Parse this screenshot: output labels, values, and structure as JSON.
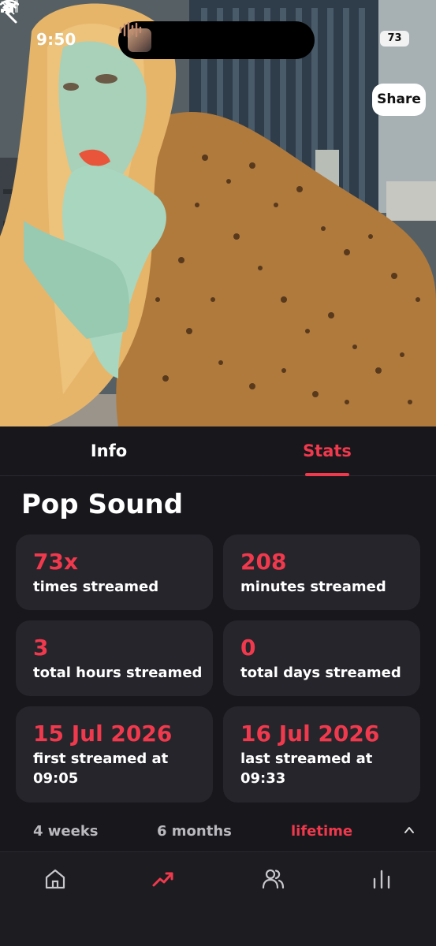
{
  "status_bar": {
    "time": "9:50",
    "battery": "73"
  },
  "header": {
    "share_label": "Share"
  },
  "tabs": [
    {
      "label": "Info",
      "active": false
    },
    {
      "label": "Stats",
      "active": true
    }
  ],
  "title": "Pop Sound",
  "stats": [
    {
      "value": "73x",
      "label": "times streamed"
    },
    {
      "value": "208",
      "label": "minutes streamed"
    },
    {
      "value": "3",
      "label": "total hours streamed"
    },
    {
      "value": "0",
      "label": "total days streamed"
    },
    {
      "value": "15 Jul 2026",
      "label": "first streamed at 09:05"
    },
    {
      "value": "16 Jul 2026",
      "label": "last streamed at 09:33"
    }
  ],
  "ranges": [
    {
      "label": "4 weeks",
      "active": false
    },
    {
      "label": "6 months",
      "active": false
    },
    {
      "label": "lifetime",
      "active": true
    }
  ],
  "bottom_nav": [
    {
      "icon": "home-icon",
      "active": false
    },
    {
      "icon": "trending-icon",
      "active": true
    },
    {
      "icon": "people-icon",
      "active": false
    },
    {
      "icon": "bar-chart-icon",
      "active": false
    }
  ],
  "colors": {
    "accent": "#f0394d",
    "background": "#18171c",
    "card": "#26252b",
    "muted_text": "#b9b9be"
  }
}
